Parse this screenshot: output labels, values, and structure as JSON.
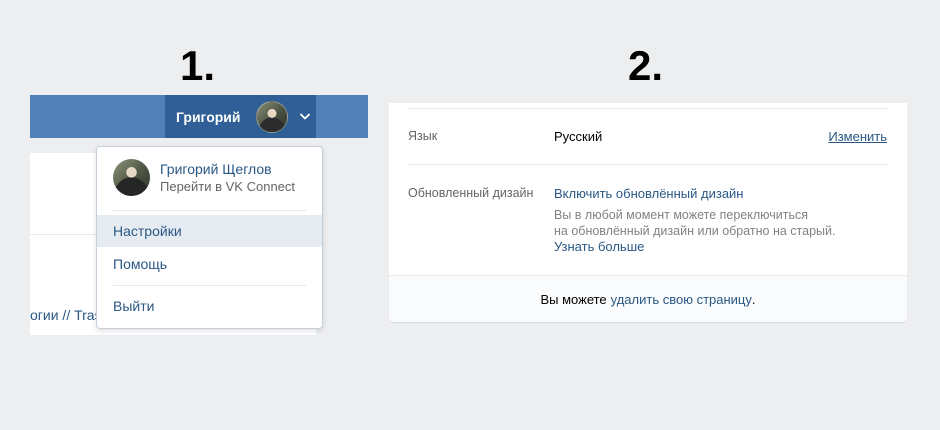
{
  "steps": {
    "one": "1.",
    "two": "2."
  },
  "header": {
    "profile_name": "Григорий",
    "avatar_icon": "user-avatar",
    "chevron_icon": "chevron-down-icon",
    "bar_color": "#5181b8",
    "active_color": "#2f5f96"
  },
  "page": {
    "partial_text": "огии // Tras"
  },
  "dropdown": {
    "user_name": "Григорий Щеглов",
    "vk_connect": "Перейти в VK Connect",
    "items": [
      {
        "label": "Настройки",
        "active": true
      },
      {
        "label": "Помощь",
        "active": false
      },
      {
        "label": "Выйти",
        "active": false
      }
    ]
  },
  "settings": {
    "language_label": "Язык",
    "language_value": "Русский",
    "language_change": "Изменить",
    "design_label": "Обновленный дизайн",
    "design_enable": "Включить обновлённый дизайн",
    "design_desc_line1": "Вы в любой момент можете переключиться",
    "design_desc_line2": "на обновлённый дизайн или обратно на старый.",
    "design_more": "Узнать больше",
    "footer_prefix": "Вы можете",
    "footer_link": "удалить свою страницу",
    "footer_suffix": "."
  },
  "colors": {
    "link": "#2a5885",
    "background": "#edeef0"
  }
}
